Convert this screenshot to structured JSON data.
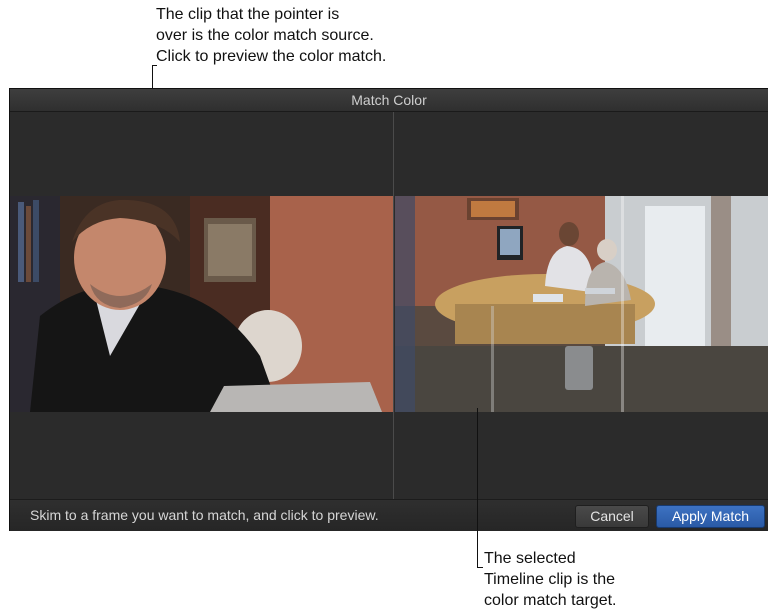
{
  "callouts": {
    "top": "The clip that the pointer is\nover is the color match source.\nClick to preview the color match.",
    "bottom": "The selected\nTimeline clip is the\ncolor match target."
  },
  "window": {
    "title": "Match Color"
  },
  "bottom_bar": {
    "instruction": "Skim to a frame you want to match, and click to preview.",
    "cancel_label": "Cancel",
    "apply_label": "Apply Match"
  },
  "colors": {
    "window_bg": "#2c2c2c",
    "accent_button": "#2f62b0"
  }
}
